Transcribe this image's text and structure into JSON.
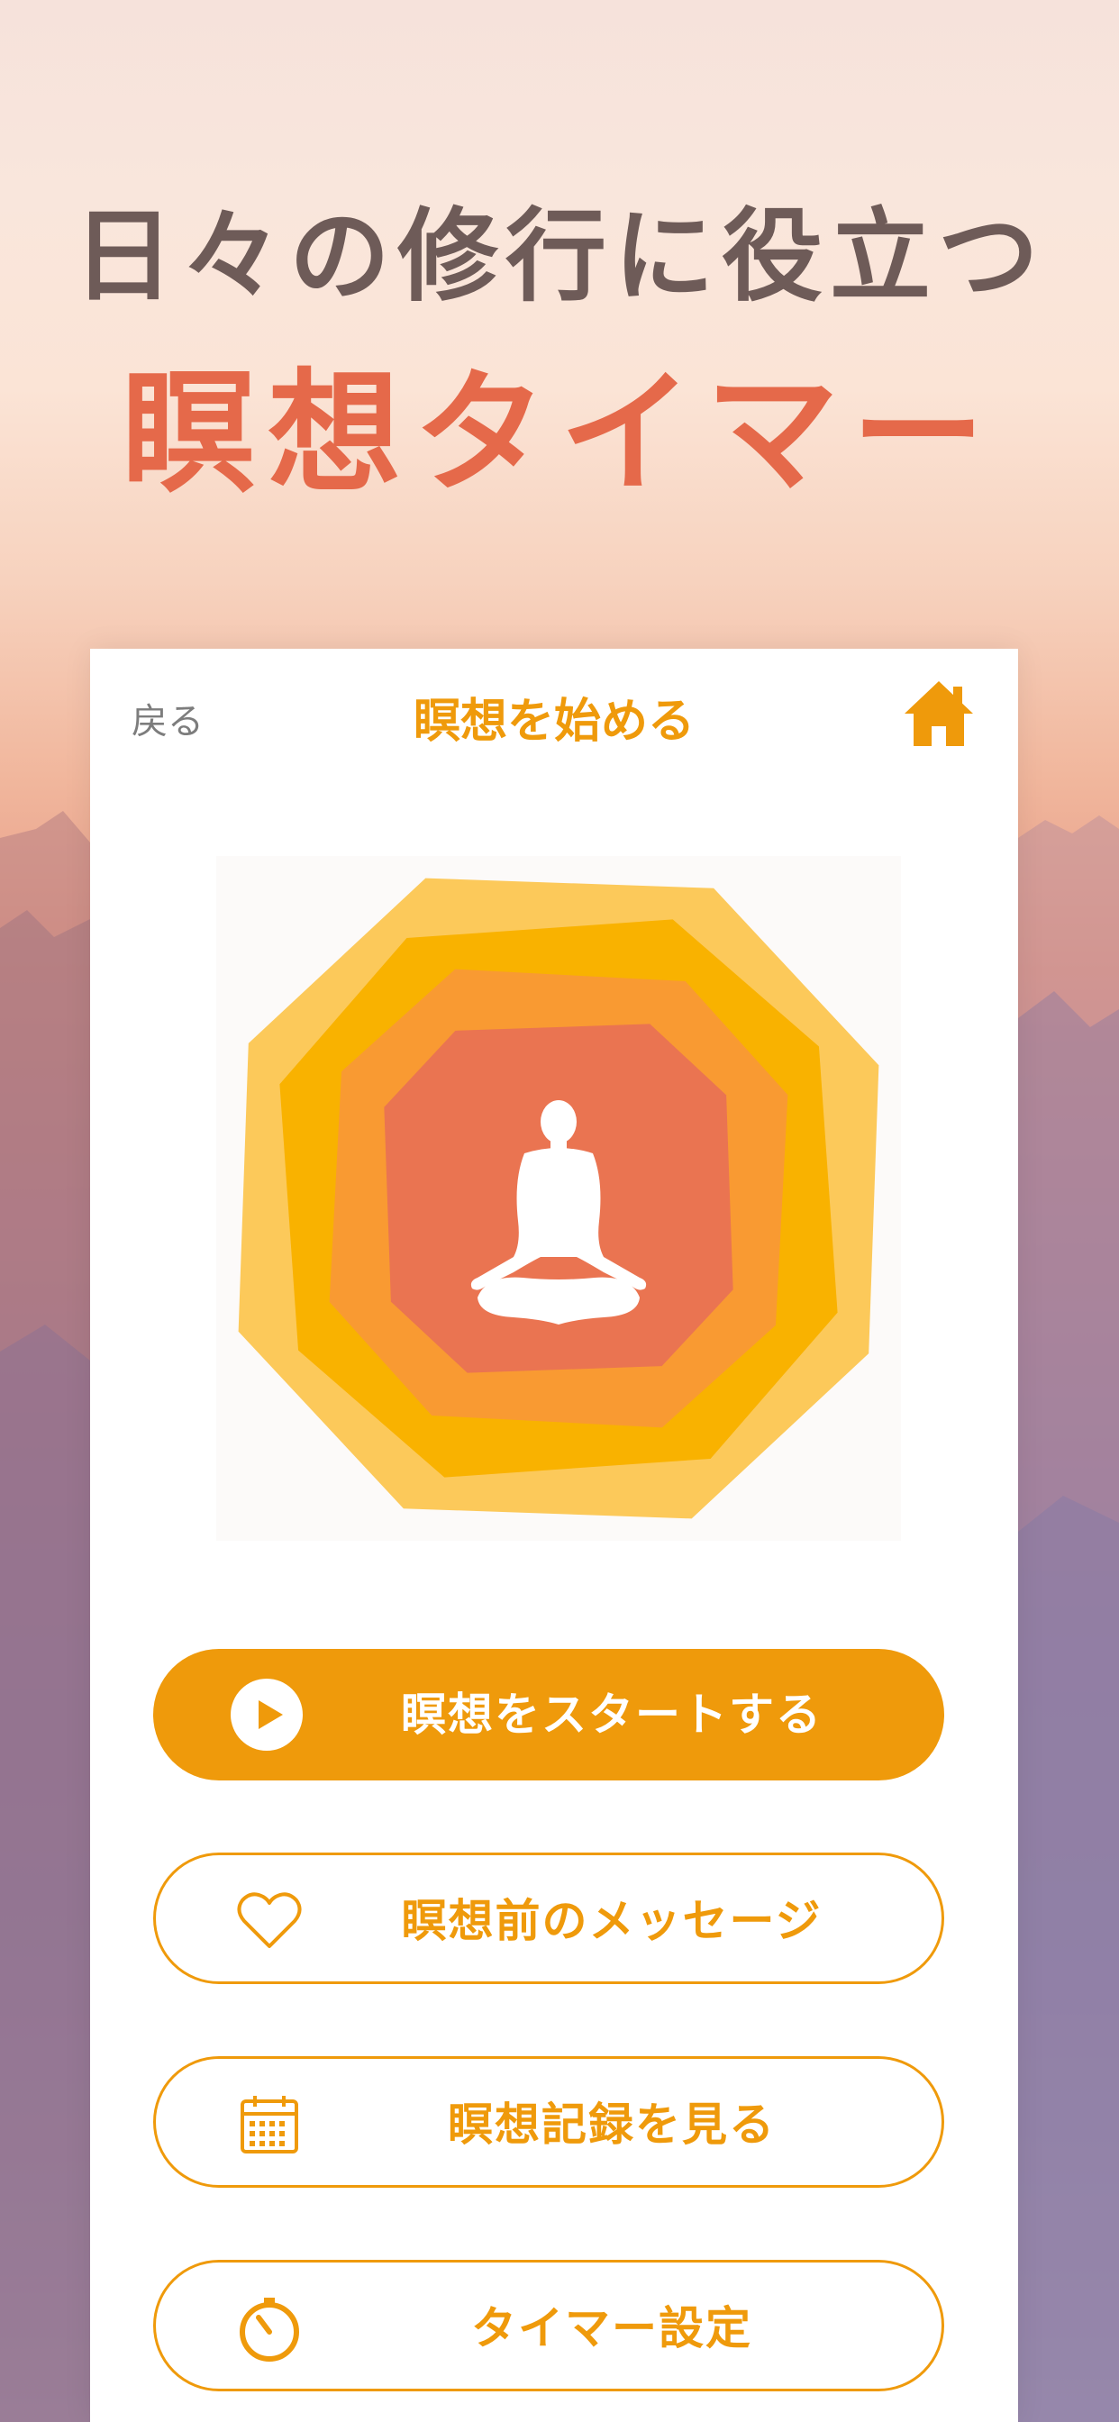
{
  "headline": {
    "line1": "日々の修行に役立つ",
    "line2": "瞑想タイマー"
  },
  "nav": {
    "back_label": "戻る",
    "title": "瞑想を始める",
    "home_icon": "home-icon"
  },
  "buttons": [
    {
      "label": "瞑想をスタートする",
      "icon": "play-icon",
      "style": "primary"
    },
    {
      "label": "瞑想前のメッセージ",
      "icon": "heart-icon",
      "style": "outline"
    },
    {
      "label": "瞑想記録を見る",
      "icon": "calendar-icon",
      "style": "outline"
    },
    {
      "label": "タイマー設定",
      "icon": "timer-icon",
      "style": "outline"
    }
  ],
  "colors": {
    "accent": "#ef9a0b",
    "headline_dark": "#6e5b58",
    "headline_accent": "#e5694a",
    "octagon_outer": "#fcc95a",
    "octagon_2": "#f9b200",
    "octagon_3": "#f99a32",
    "octagon_inner": "#ea7451"
  }
}
